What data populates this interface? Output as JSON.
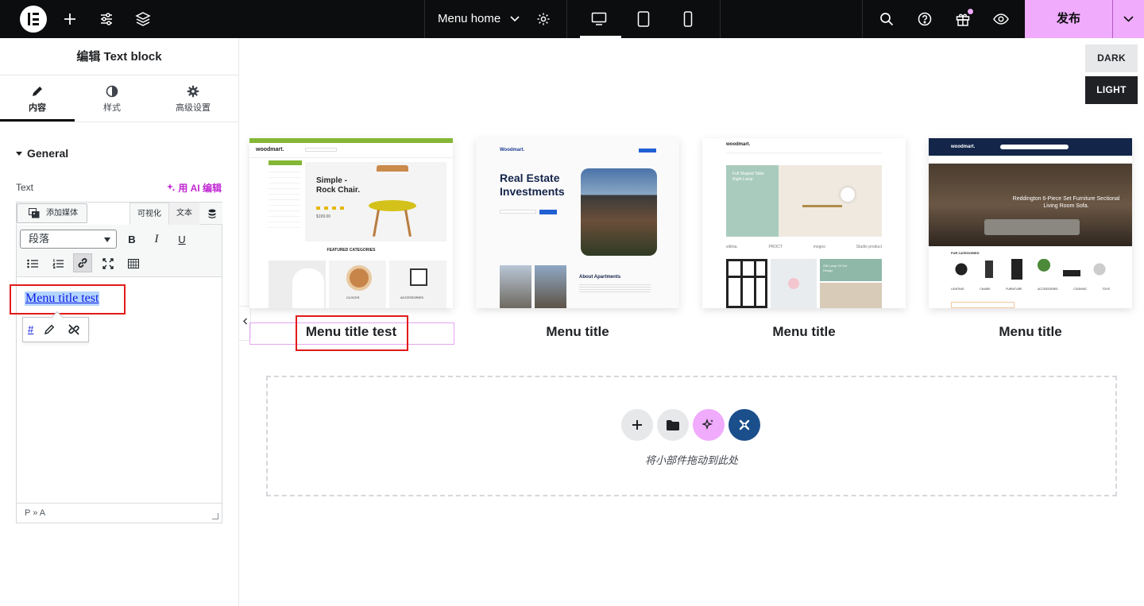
{
  "topbar": {
    "page_name": "Menu home",
    "publish_label": "发布"
  },
  "panel": {
    "title": "编辑 Text block",
    "tabs": [
      {
        "label": "内容"
      },
      {
        "label": "样式"
      },
      {
        "label": "高级设置"
      }
    ],
    "section_title": "General",
    "text_label": "Text",
    "ai_edit_label": "用 AI 编辑",
    "add_media_label": "添加媒体",
    "mode_visual": "可视化",
    "mode_text": "文本",
    "format_value": "段落",
    "bold": "B",
    "italic": "I",
    "underline": "U",
    "content_link_text": "Menu title test",
    "link_popup_href": "#",
    "status_path": "P » A"
  },
  "canvas": {
    "theme_dark": "DARK",
    "theme_light": "LIGHT",
    "cards": [
      {
        "title": "Menu title test",
        "thumb": {
          "brand": "woodmart.",
          "headline": "Simple - Rock Chair.",
          "price": "$199.00",
          "section": "FEATURED CATEGORIES",
          "cats": [
            "CLOCKS",
            "ACCESSORIES"
          ]
        }
      },
      {
        "title": "Menu title",
        "thumb": {
          "brand": "Woodmart.",
          "headline": "Real Estate Investments",
          "section": "About Apartments"
        }
      },
      {
        "title": "Menu title",
        "thumb": {
          "brand": "woodmart.",
          "hero_text": "Full Shaped Table Right Lamp",
          "promo": "Gift Lamp Of Our Design",
          "brands": [
            "sittma.",
            "PROCT",
            "mogoo",
            "Studio product"
          ]
        }
      },
      {
        "title": "Menu title",
        "thumb": {
          "brand": "woodmart.",
          "headline": "Reddington 6-Piece Set Furniture Sectional Living Room Sofa.",
          "section": "FUR CATEGORIES",
          "cats": [
            "LIGHTING",
            "CHAIRS",
            "FURNITURE",
            "ACCESSORIES",
            "COOKING",
            "TOYS"
          ]
        }
      }
    ],
    "dropzone_text": "将小部件拖动到此处"
  },
  "colors": {
    "accent_pink": "#f0abfc",
    "selection_red": "#e21a1a",
    "link_blue": "#0b1ae6"
  }
}
